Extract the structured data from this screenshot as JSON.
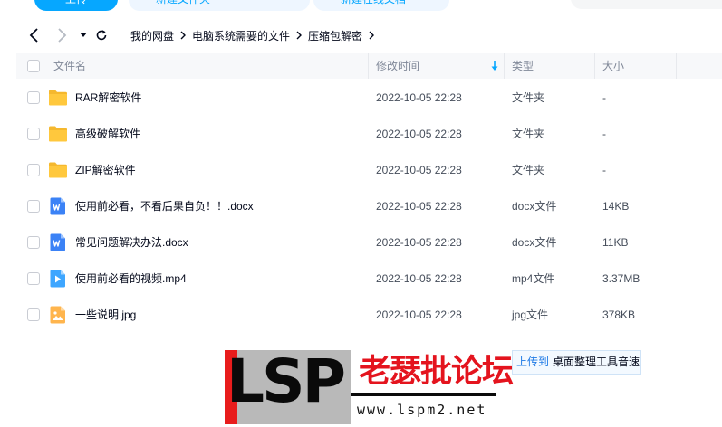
{
  "topbar": {
    "primary_label": "上传",
    "pill_a_label": "新建文件夹",
    "pill_b_label": "新建在线文档"
  },
  "breadcrumb": {
    "items": [
      "我的网盘",
      "电脑系统需要的文件",
      "压缩包解密"
    ]
  },
  "table": {
    "columns": {
      "name": "文件名",
      "modified": "修改时间",
      "type": "类型",
      "size": "大小"
    },
    "rows": [
      {
        "icon": "folder-icon",
        "name": "RAR解密软件",
        "modified": "2022-10-05 22:28",
        "type": "文件夹",
        "size": "-"
      },
      {
        "icon": "folder-icon",
        "name": "高级破解软件",
        "modified": "2022-10-05 22:28",
        "type": "文件夹",
        "size": "-"
      },
      {
        "icon": "folder-icon",
        "name": "ZIP解密软件",
        "modified": "2022-10-05 22:28",
        "type": "文件夹",
        "size": "-"
      },
      {
        "icon": "word-doc-icon",
        "name": "使用前必看，不看后果自负！！.docx",
        "modified": "2022-10-05 22:28",
        "type": "docx文件",
        "size": "14KB"
      },
      {
        "icon": "word-doc-icon",
        "name": "常见问题解决办法.docx",
        "modified": "2022-10-05 22:28",
        "type": "docx文件",
        "size": "11KB"
      },
      {
        "icon": "video-file-icon",
        "name": "使用前必看的视频.mp4",
        "modified": "2022-10-05 22:28",
        "type": "mp4文件",
        "size": "3.37MB"
      },
      {
        "icon": "image-file-icon",
        "name": "一些说明.jpg",
        "modified": "2022-10-05 22:28",
        "type": "jpg文件",
        "size": "378KB"
      }
    ]
  },
  "watermark": {
    "brand": "LSP",
    "name": "老瑟批论坛",
    "url": "www.lspm2.net"
  },
  "upload_tip": {
    "link": "上传到",
    "text": "桌面整理工具音速"
  },
  "colors": {
    "accent": "#06a7ff",
    "folder": "#ffc83d",
    "word": "#3b82f6",
    "video": "#3ea6ff",
    "image": "#ffb54d",
    "watermark_red": "#e4141e"
  }
}
